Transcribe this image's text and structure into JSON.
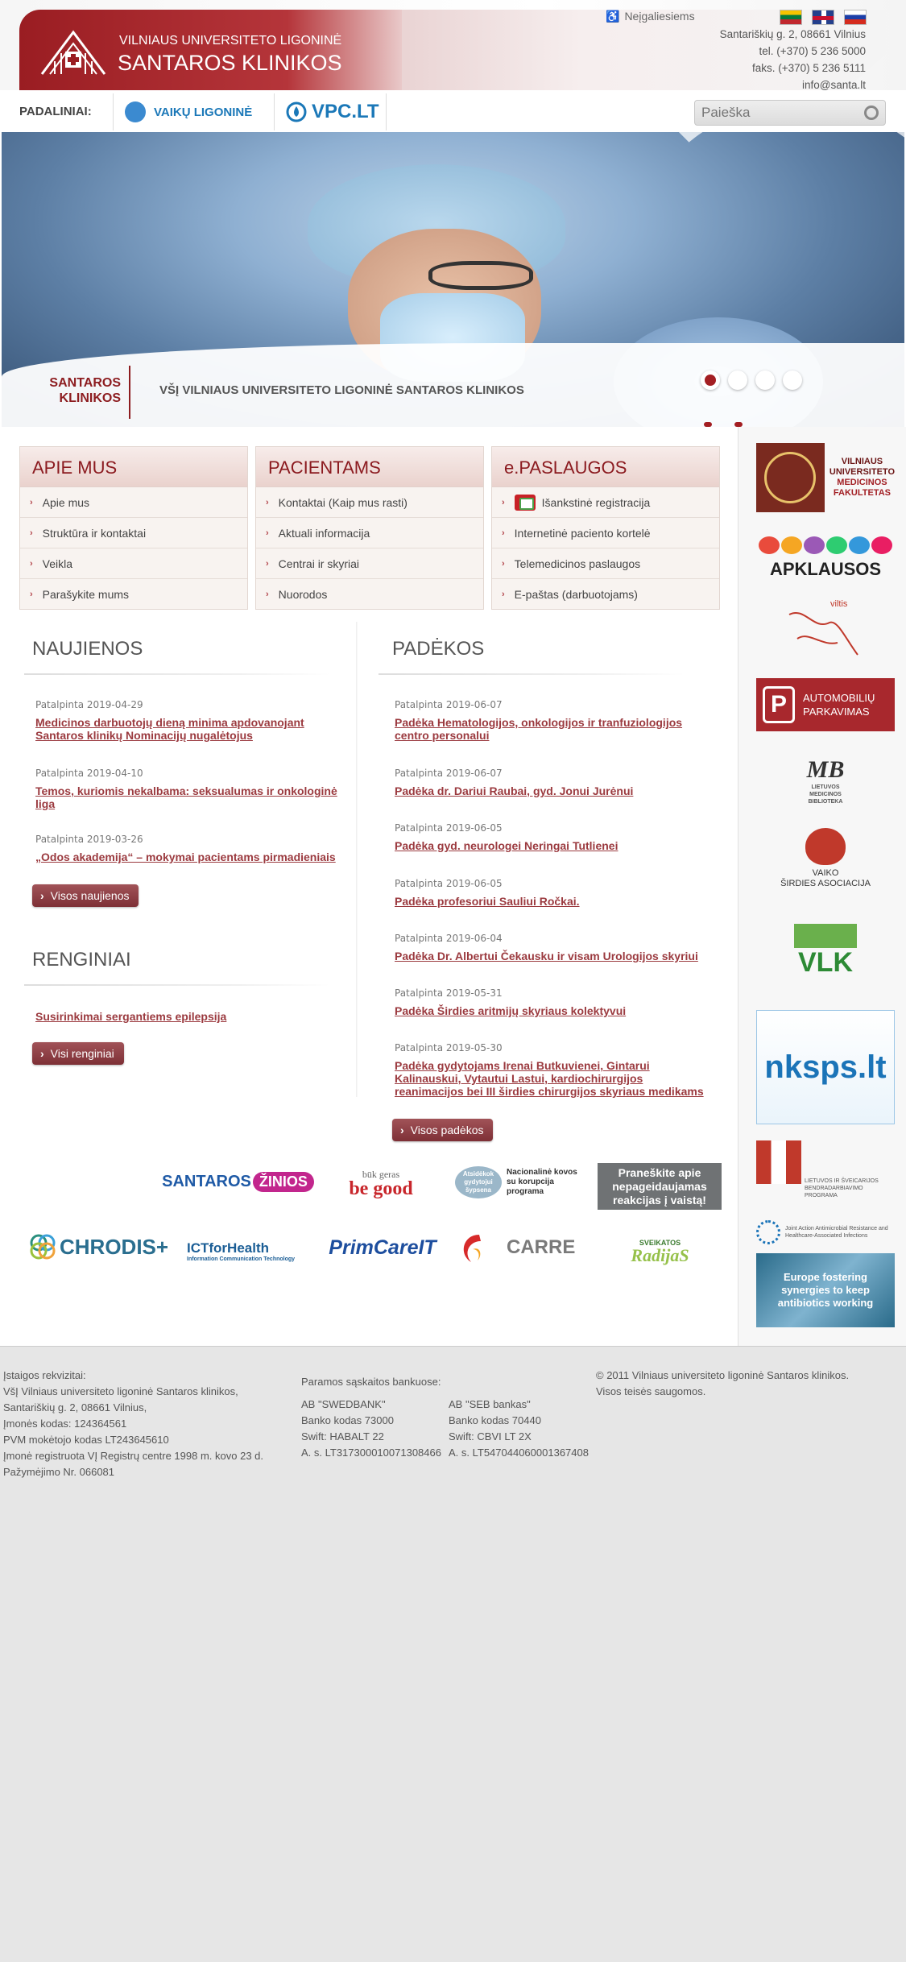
{
  "header": {
    "uni": "VILNIAUS UNIVERSITETO LIGONINĖ",
    "name": "SANTAROS KLINIKOS",
    "accessibility": "Neįgaliesiems",
    "address": "Santariškių g. 2, 08661 Vilnius",
    "tel": "tel. (+370) 5 236 5000",
    "fax": "faks. (+370) 5 236 5111",
    "email": "info@santa.lt"
  },
  "subnav": {
    "label": "PADALINIAI:",
    "vaiku": "VAIKŲ LIGONINĖ",
    "vpc": "VPC.LT",
    "search_placeholder": "Paieška"
  },
  "hero": {
    "logo_line1": "SANTAROS",
    "logo_line2": "KLINIKOS",
    "title": "VŠĮ VILNIAUS UNIVERSITETO LIGONINĖ SANTAROS KLINIKOS"
  },
  "boxes": [
    {
      "title": "APIE MUS",
      "items": [
        "Apie mus",
        "Struktūra ir kontaktai",
        "Veikla",
        "Parašykite mums"
      ]
    },
    {
      "title": "PACIENTAMS",
      "items": [
        "Kontaktai (Kaip mus rasti)",
        "Aktuali informacija",
        "Centrai ir skyriai",
        "Nuorodos"
      ]
    },
    {
      "title": "e.PASLAUGOS",
      "items": [
        "Išankstinė registracija",
        "Internetinė paciento kortelė",
        "Telemedicinos paslaugos",
        "E-paštas (darbuotojams)"
      ]
    }
  ],
  "naujienos": {
    "title": "NAUJIENOS",
    "items": [
      {
        "date": "Patalpinta 2019-04-29",
        "title": "Medicinos darbuotojų dieną minima apdovanojant Santaros klinikų Nominacijų nugalėtojus"
      },
      {
        "date": "Patalpinta 2019-04-10",
        "title": "Temos, kuriomis nekalbama: seksualumas ir onkologinė liga"
      },
      {
        "date": "Patalpinta 2019-03-26",
        "title": "„Odos akademija“ – mokymai pacientams pirmadieniais"
      }
    ],
    "button": "Visos naujienos"
  },
  "renginiai": {
    "title": "RENGINIAI",
    "items": [
      "Susirinkimai sergantiems epilepsija"
    ],
    "button": "Visi renginiai"
  },
  "padekos": {
    "title": "PADĖKOS",
    "items": [
      {
        "date": "Patalpinta 2019-06-07",
        "title": "Padėka Hematologijos, onkologijos ir tranfuziologijos centro personalui"
      },
      {
        "date": "Patalpinta 2019-06-07",
        "title": "Padėka dr. Dariui Raubai, gyd. Jonui Jurėnui"
      },
      {
        "date": "Patalpinta 2019-06-05",
        "title": "Padėka gyd. neurologei Neringai Tutlienei"
      },
      {
        "date": "Patalpinta 2019-06-05",
        "title": "Padėka profesoriui Sauliui Ročkai."
      },
      {
        "date": "Patalpinta 2019-06-04",
        "title": "Padėka Dr. Albertui Čekausku ir visam Urologijos skyriui"
      },
      {
        "date": "Patalpinta 2019-05-31",
        "title": "Padėka Širdies aritmijų skyriaus kolektyvui"
      },
      {
        "date": "Patalpinta 2019-05-30",
        "title": "Padėka gydytojams Irenai Butkuvienei, Gintarui Kalinauskui, Vytautui Lastui, kardiochirurgijos reanimacijos bei III širdies chirurgijos skyriaus medikams"
      }
    ],
    "button": "Visos padėkos"
  },
  "partners": {
    "santaros": "SANTAROS",
    "zinios": "ŽINIOS",
    "begood_small": "būk geras",
    "begood_big": "be good",
    "korupcija": "Nacionalinė kovos su korupcija programa",
    "korupcija_badge": "Atsidėkok gydytojui šypsena",
    "praneskite": "Praneškite apie nepageidaujamas reakcijas į vaistą!",
    "chrodis": "CHRODIS+",
    "ict": "ICTforHealth",
    "ict_sub": "Information Communication Technology",
    "primcare": "PrimCareIT",
    "carre": "CARRE",
    "radijas_top": "SVEIKATOS",
    "radijas": "RadijaS"
  },
  "sidebar": {
    "vu_l1": "VILNIAUS",
    "vu_l2": "UNIVERSITETO",
    "vu_l3": "MEDICINOS",
    "vu_l4": "FAKULTETAS",
    "apklausos": "APKLAUSOS",
    "viltis": "viltis",
    "parking1": "AUTOMOBILIŲ",
    "parking2": "PARKAVIMAS",
    "lmb": "LIETUVOS MEDICINOS BIBLIOTEKA",
    "vsa1": "VAIKO",
    "vsa2": "ŠIRDIES ASOCIACIJA",
    "vlk": "VLK",
    "nksps": "nksps.lt",
    "ltch": "LIETUVOS IR ŠVEICARIJOS BENDRADARBIAVIMO PROGRAMA",
    "jaamr": "Joint Action Antimicrobial Resistance and Healthcare-Associated Infections",
    "eu": "Europe fostering synergies to keep antibiotics working"
  },
  "footer": {
    "req_title": "Įstaigos rekvizitai:",
    "req": [
      "VšĮ Vilniaus universiteto ligoninė Santaros klinikos,",
      "Santariškių g. 2, 08661 Vilnius,",
      "Įmonės kodas: 124364561",
      "PVM mokėtojo kodas LT243645610",
      "Įmonė registruota VĮ Registrų centre 1998 m. kovo 23 d.",
      "Pažymėjimo Nr. 066081"
    ],
    "bank_title": "Paramos sąskaitos bankuose:",
    "bank1": [
      "AB \"SWEDBANK\"",
      "Banko kodas 73000",
      "Swift: HABALT 22",
      "A. s. LT317300010071308466"
    ],
    "bank2": [
      "AB \"SEB bankas\"",
      "Banko kodas 70440",
      "Swift: CBVI LT 2X",
      "A. s. LT547044060001367408"
    ],
    "copyright": [
      "© 2011 Vilniaus universiteto ligoninė Santaros klinikos.",
      "Visos teisės saugomos."
    ]
  }
}
